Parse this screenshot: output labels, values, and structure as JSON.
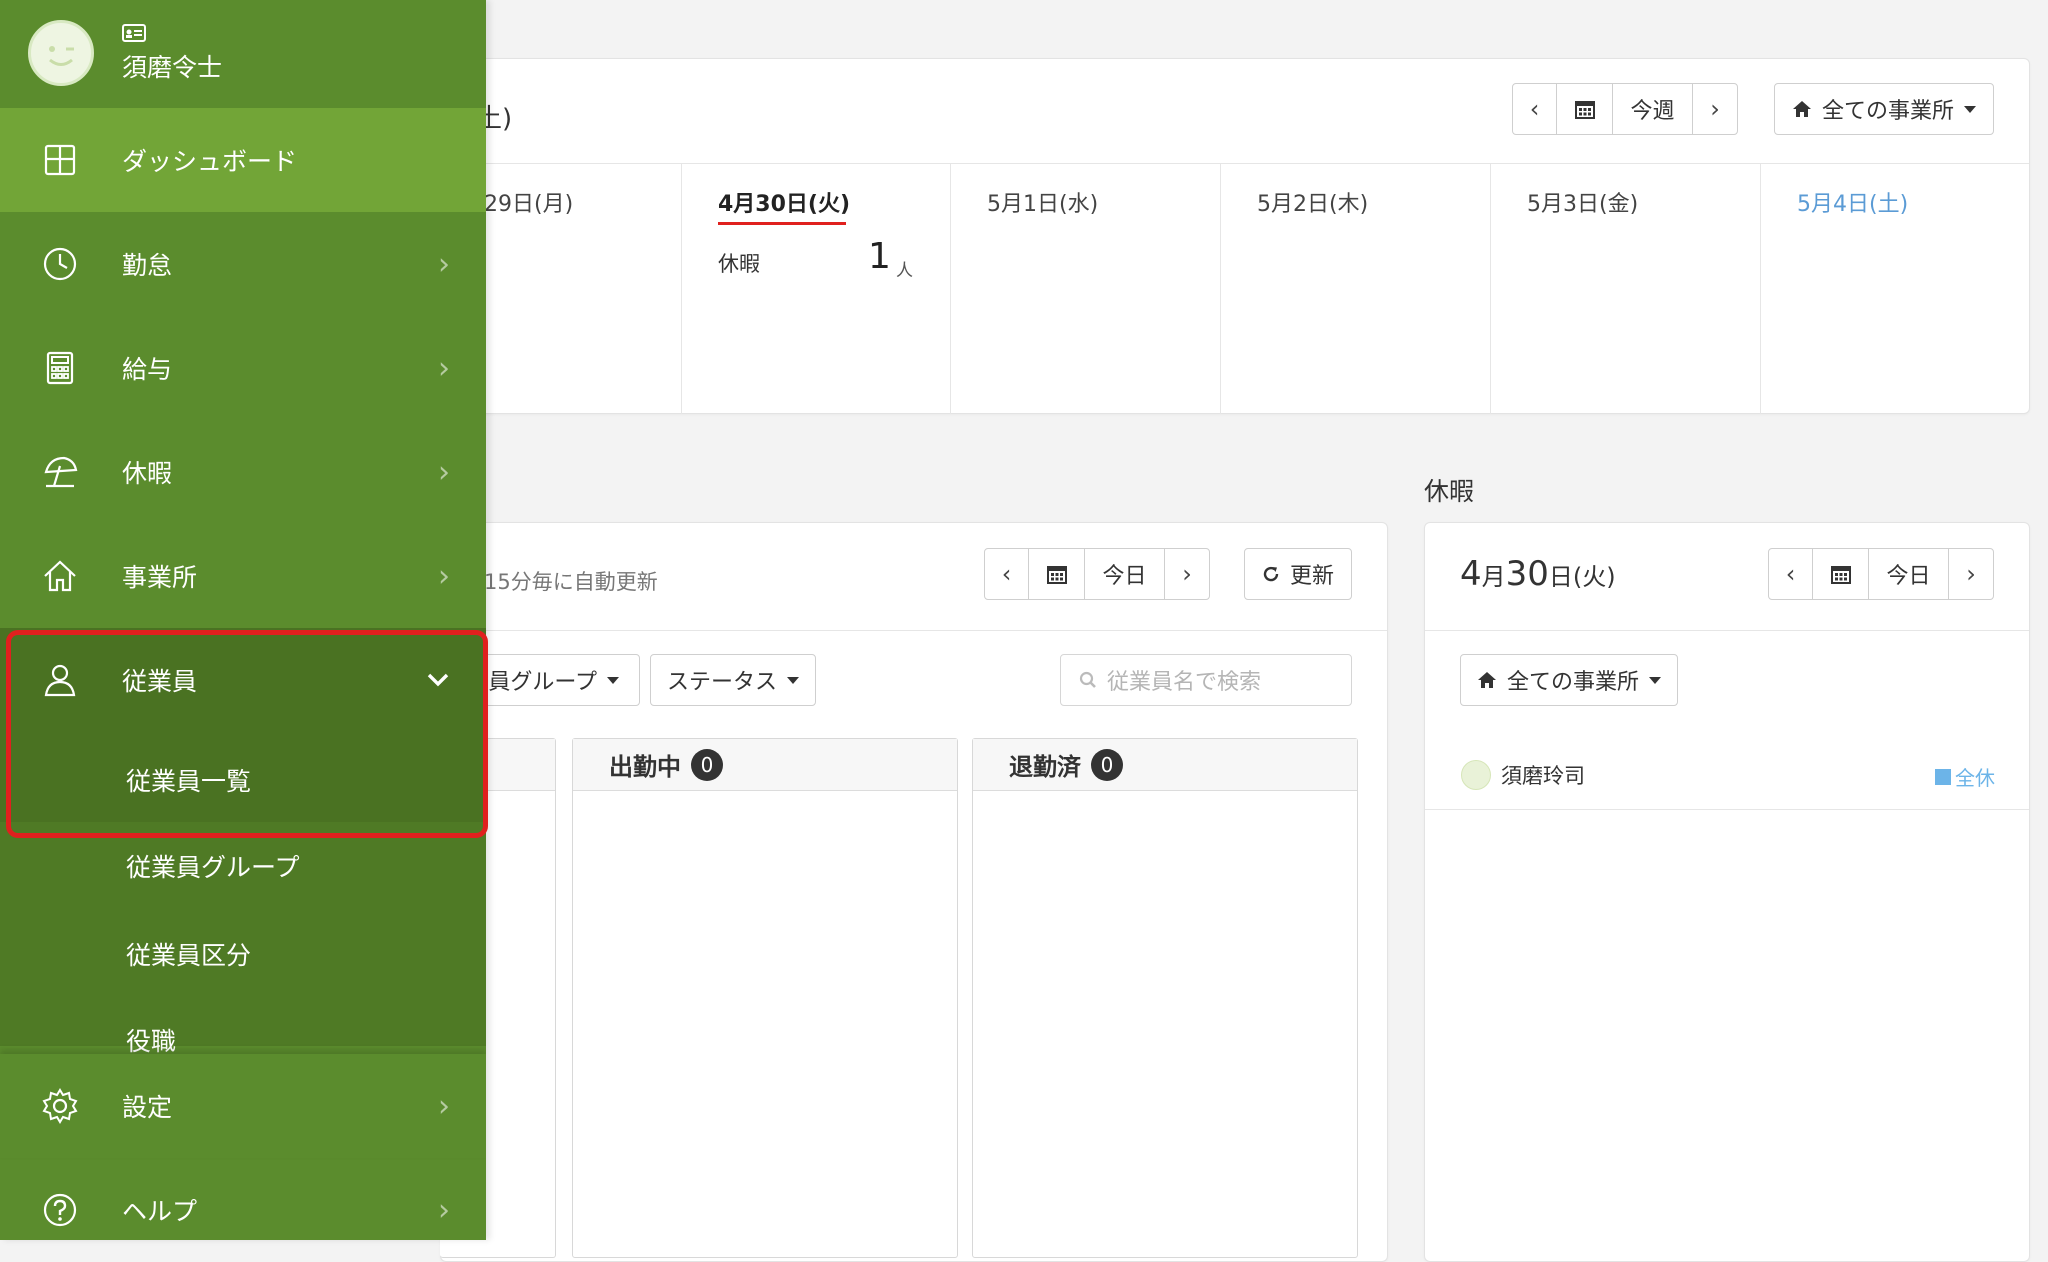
{
  "user": {
    "name": "須磨令士"
  },
  "sidebar": {
    "items": [
      {
        "label": "ダッシュボード",
        "icon": "dashboard-grid-icon"
      },
      {
        "label": "勤怠",
        "icon": "clock-icon"
      },
      {
        "label": "給与",
        "icon": "calculator-icon"
      },
      {
        "label": "休暇",
        "icon": "beach-umbrella-icon"
      },
      {
        "label": "事業所",
        "icon": "home-icon"
      },
      {
        "label": "従業員",
        "icon": "person-icon"
      },
      {
        "label": "設定",
        "icon": "gear-icon"
      },
      {
        "label": "ヘルプ",
        "icon": "help-icon"
      }
    ],
    "employee_submenu": [
      "従業員一覧",
      "従業員グループ",
      "従業員区分",
      "役職"
    ]
  },
  "week_card": {
    "title_fragment": "土)",
    "today_button": "今週",
    "office_filter": "全ての事業所",
    "days": [
      {
        "label": "29日(月)"
      },
      {
        "label": "4月30日(火)",
        "leave_label": "休暇",
        "count": "1",
        "count_unit": "人"
      },
      {
        "label": "5月1日(水)"
      },
      {
        "label": "5月2日(木)"
      },
      {
        "label": "5月3日(金)"
      },
      {
        "label": "5月4日(土)"
      }
    ]
  },
  "attendance_card": {
    "auto_refresh_text": "15分毎に自動更新",
    "today_button": "今日",
    "refresh_button": "更新",
    "group_filter": "員グループ",
    "status_filter": "ステータス",
    "search_placeholder": "従業員名で検索",
    "columns": [
      {
        "label": "出勤中",
        "count": "0"
      },
      {
        "label": "退勤済",
        "count": "0"
      }
    ]
  },
  "leave_section": {
    "heading": "休暇",
    "date_big": "4",
    "date_month": "月",
    "date_day": "30",
    "date_suffix": "日(火)",
    "today_button": "今日",
    "office_filter": "全ての事業所",
    "entries": [
      {
        "name": "須磨玲司",
        "tag": "全休"
      }
    ]
  },
  "colors": {
    "sidebar_bg": "#5b8c2d",
    "sidebar_active": "#72a537",
    "sidebar_expanded": "#4a7222",
    "highlight_border": "#e0201e",
    "today_underline": "#e0201e",
    "saturday_text": "#5b9bd5",
    "leave_tag": "#6cb4e8"
  }
}
